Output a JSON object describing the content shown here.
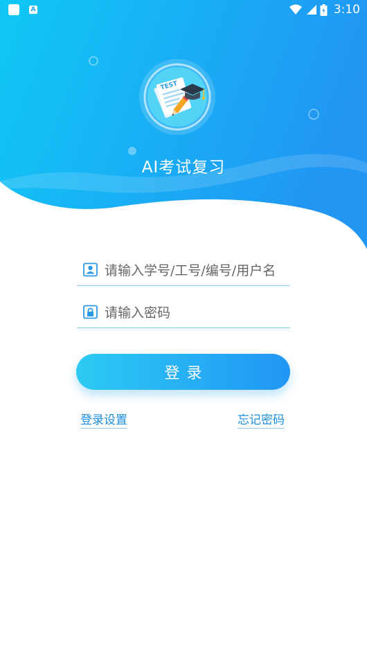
{
  "app": {
    "title": "AI考试复习"
  },
  "status_bar": {
    "time": "3:10",
    "icons": [
      "notification-square-icon",
      "a-notification-icon",
      "wifi-icon",
      "cell-signal-icon",
      "battery-icon"
    ]
  },
  "logo": {
    "icon": "test-paper-graduation-cap-icon",
    "paper_text": "TEST"
  },
  "login_form": {
    "username": {
      "placeholder": "请输入学号/工号/编号/用户名",
      "value": "",
      "icon": "user-card-icon"
    },
    "password": {
      "placeholder": "请输入密码",
      "value": "",
      "icon": "lock-icon"
    },
    "submit_label": "登录",
    "settings_link": "登录设置",
    "forgot_link": "忘记密码"
  },
  "colors": {
    "gradient_start": "#10c8f6",
    "gradient_end": "#2196f3",
    "button_start": "#2dcaf3",
    "button_end": "#2196f5",
    "link": "#1a8de0",
    "field_line": "#7fcdf1"
  }
}
